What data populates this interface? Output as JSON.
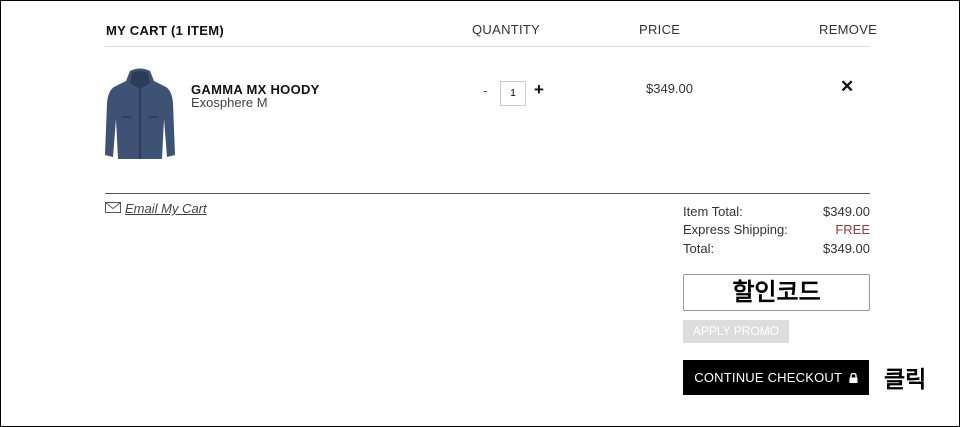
{
  "header": {
    "cart_label": "MY CART  (1 ITEM)",
    "quantity": "QUANTITY",
    "price": "PRICE",
    "remove": "REMOVE"
  },
  "item": {
    "name": "GAMMA MX HOODY",
    "variant": "Exosphere M",
    "quantity": "1",
    "price": "$349.00",
    "image_icon": "jacket-icon",
    "colors": {
      "jacket": "#3e5275"
    }
  },
  "controls": {
    "minus": "-",
    "plus": "+",
    "remove": "✕"
  },
  "email": {
    "label": "Email My Cart",
    "icon": "envelope-icon"
  },
  "summary": {
    "item_total_label": "Item Total:",
    "item_total_value": "$349.00",
    "shipping_label": "Express Shipping:",
    "shipping_value": "FREE",
    "total_label": "Total:",
    "total_value": "$349.00"
  },
  "promo": {
    "input_value": "할인코드",
    "apply_label": "APPLY PROMO"
  },
  "checkout": {
    "label": "CONTINUE CHECKOUT",
    "icon": "lock-icon"
  },
  "annotation": {
    "click_label": "클릭"
  },
  "colors": {
    "free": "#9b3b3b",
    "checkout_bg": "#000000",
    "apply_bg": "#dddddd"
  }
}
